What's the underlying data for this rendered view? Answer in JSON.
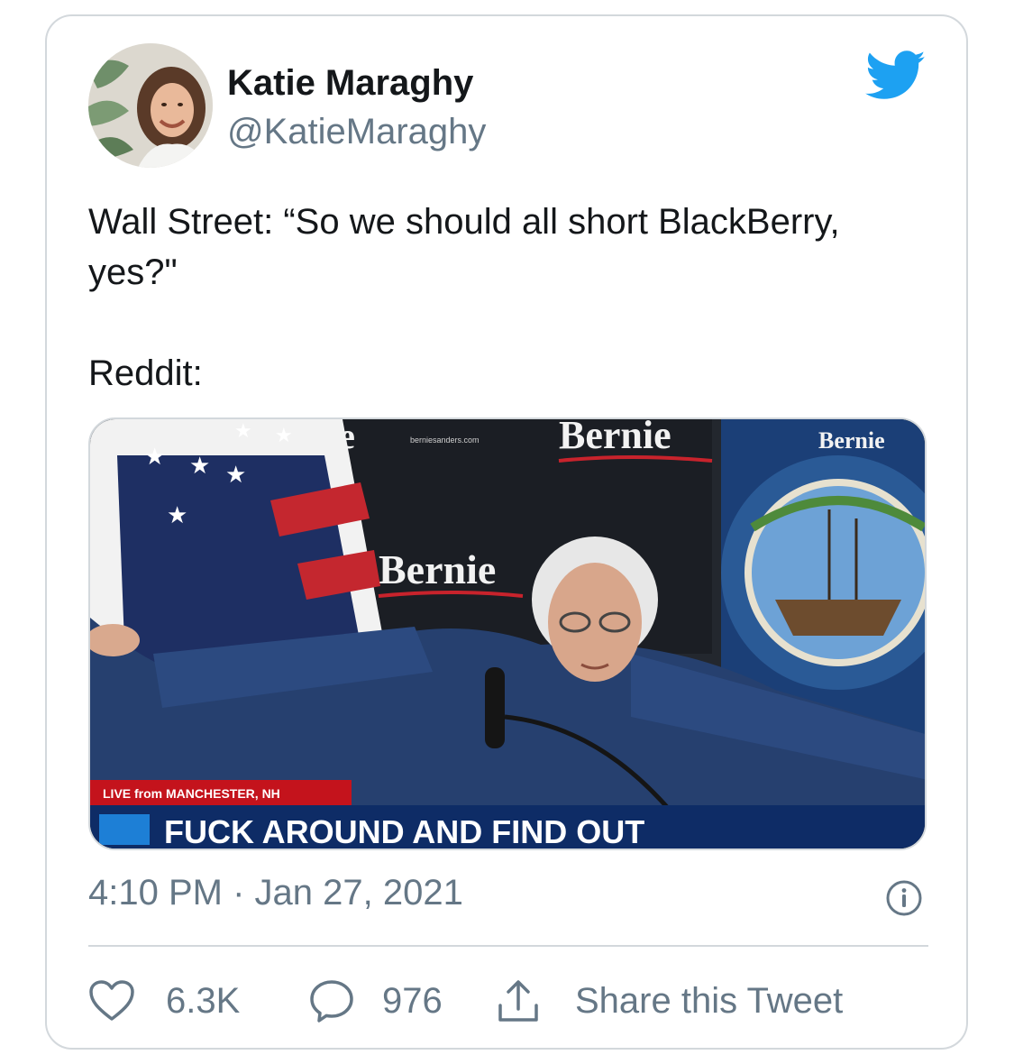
{
  "author": {
    "display_name": "Katie Maraghy",
    "handle": "@KatieMaraghy"
  },
  "tweet": {
    "line1": "Wall Street: “So we should all short BlackBerry, yes?\"",
    "line2": "Reddit:"
  },
  "media": {
    "backdrop_text_1": "Bernie",
    "backdrop_text_2": "Bernie",
    "backdrop_text_3": "Bernie",
    "backdrop_text_partial": "ie",
    "backdrop_url": "berniesanders.com",
    "live_label": "LIVE from MANCHESTER, NH",
    "caption": "FUCK AROUND AND FIND OUT"
  },
  "meta": {
    "timestamp": "4:10 PM · Jan 27, 2021"
  },
  "actions": {
    "likes": "6.3K",
    "replies": "976",
    "share_label": "Share this Tweet"
  },
  "colors": {
    "twitter_blue": "#1da1f2",
    "secondary_text": "#657786",
    "primary_text": "#14171a",
    "border": "#d3d8dc"
  }
}
